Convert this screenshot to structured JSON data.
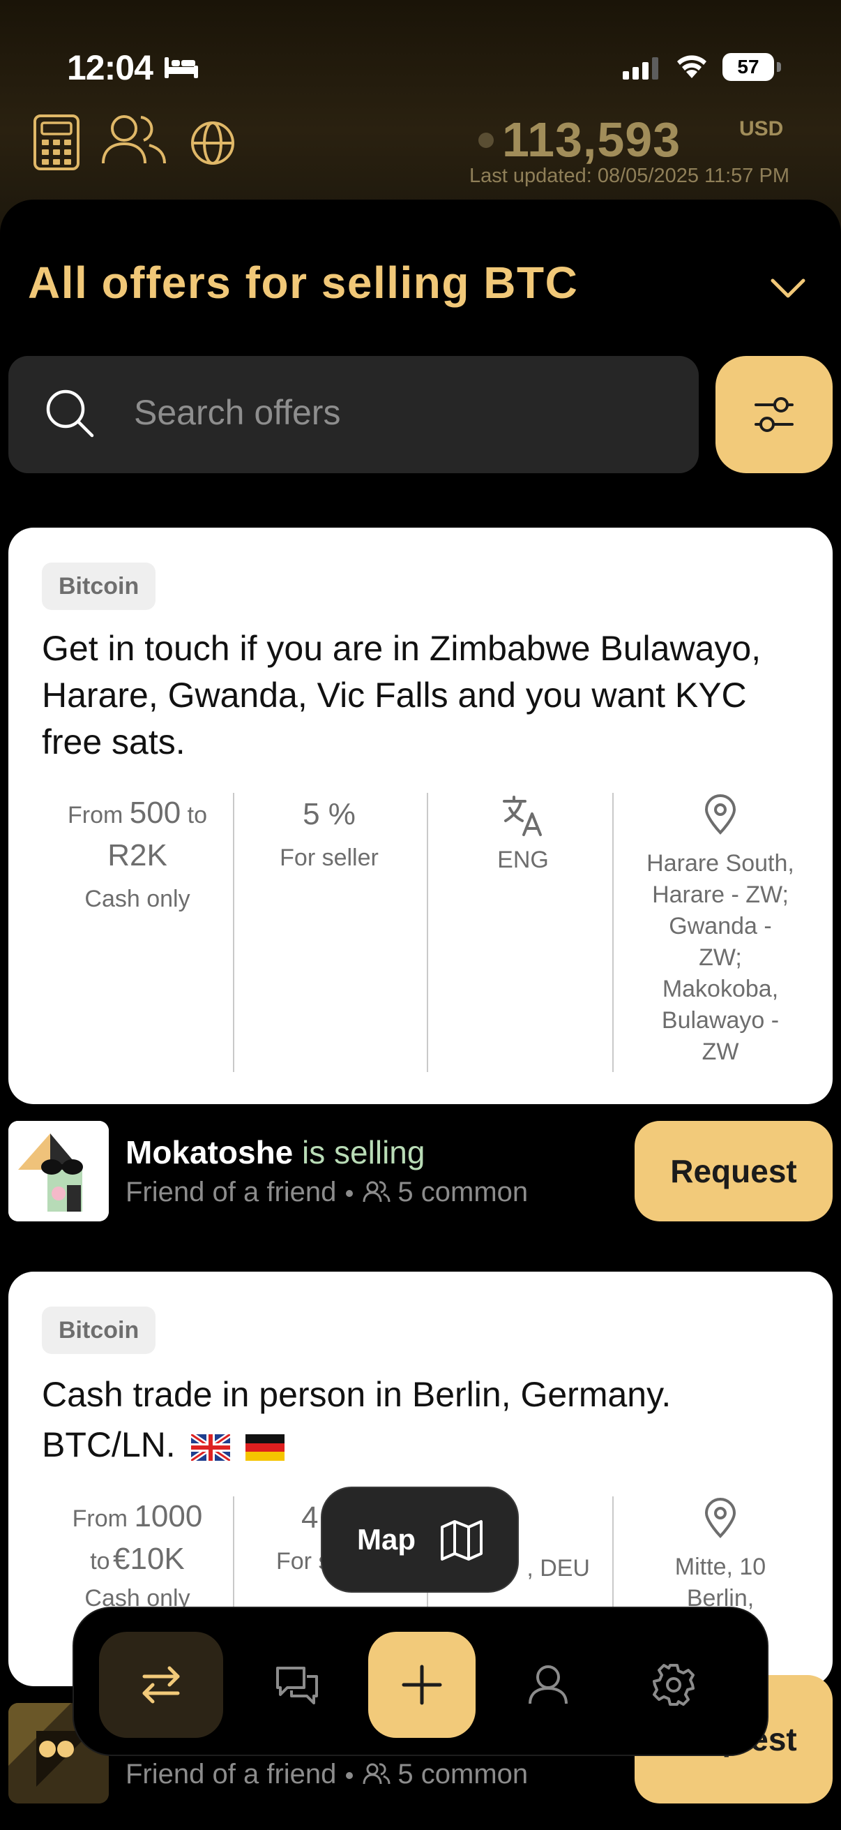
{
  "status_bar": {
    "time": "12:04",
    "battery": "57"
  },
  "header": {
    "balance": "113,593",
    "currency": "USD",
    "last_updated": "Last updated: 08/05/2025 11:57 PM"
  },
  "page_title": "All offers for selling BTC",
  "search": {
    "placeholder": "Search offers"
  },
  "offers": [
    {
      "badge": "Bitcoin",
      "description": "Get in touch if you are in Zimbabwe Bulawayo, Harare, Gwanda, Vic Falls and you want KYC free sats.",
      "amount_from_word": "From",
      "amount_from": "500",
      "amount_to_word": "to",
      "amount_to": "R2K",
      "payment": "Cash only",
      "fee": "5 %",
      "fee_label": "For seller",
      "language": "ENG",
      "location_lines": [
        "Harare South,",
        "Harare - ZW;",
        "Gwanda -",
        "ZW;",
        "Makokoba,",
        "Bulawayo -",
        "ZW"
      ],
      "seller": {
        "name": "Mokatoshe",
        "action": "is selling",
        "relation": "Friend of a friend",
        "common": "5 common"
      },
      "request_label": "Request"
    },
    {
      "badge": "Bitcoin",
      "description": "Cash trade in person in Berlin, Germany. BTC/LN.",
      "flags": [
        "uk-flag",
        "germany-flag"
      ],
      "amount_from_word": "From",
      "amount_from": "1000",
      "amount_to_word": "to",
      "amount_to": "€10K",
      "payment": "Cash only",
      "fee": "4",
      "fee_label": "For s",
      "language": ", DEU",
      "location_lines": [
        "Mitte, 10",
        "Berlin,"
      ],
      "seller": {
        "relation": "Friend of a friend",
        "common": "5 common"
      },
      "request_label": "Request"
    }
  ],
  "map_button": {
    "label": "Map"
  },
  "colors": {
    "accent": "#f2ca7a",
    "title": "#f1c878",
    "balance": "#a18d5a",
    "selling": "#b9dcb6",
    "nav_active": "#2c2416"
  },
  "bottom_nav": [
    "swap-icon",
    "chat-icon",
    "add-icon",
    "profile-icon",
    "settings-icon"
  ]
}
